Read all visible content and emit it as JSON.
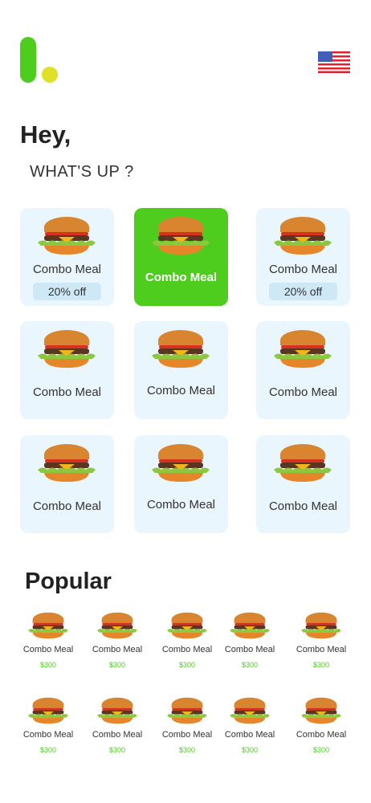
{
  "header": {
    "logo": "app-logo",
    "language": "en-US"
  },
  "greeting": {
    "title": "Hey,",
    "subtitle": "WHAT'S UP ?"
  },
  "categories": [
    {
      "name": "Combo Meal",
      "badge": "20% off",
      "selected": false
    },
    {
      "name": "Combo Meal",
      "selected": true
    },
    {
      "name": "Combo Meal",
      "badge": "20% off",
      "selected": false
    },
    {
      "name": "Combo Meal"
    },
    {
      "name": "Combo Meal"
    },
    {
      "name": "Combo Meal"
    },
    {
      "name": "Combo Meal"
    },
    {
      "name": "Combo Meal"
    },
    {
      "name": "Combo Meal"
    }
  ],
  "popular": {
    "title": "Popular",
    "items": [
      {
        "name": "Combo Meal",
        "price": "$300"
      },
      {
        "name": "Combo Meal",
        "price": "$300"
      },
      {
        "name": "Combo Meal",
        "price": "$300"
      },
      {
        "name": "Combo Meal",
        "price": "$300"
      },
      {
        "name": "Combo Meal",
        "price": "$300"
      },
      {
        "name": "Combo Meal",
        "price": "$300"
      },
      {
        "name": "Combo Meal",
        "price": "$300"
      },
      {
        "name": "Combo Meal",
        "price": "$300"
      },
      {
        "name": "Combo Meal",
        "price": "$300"
      },
      {
        "name": "Combo Meal",
        "price": "$300"
      }
    ]
  },
  "colors": {
    "accent": "#4fcd1f",
    "card": "#e9f6fd",
    "logo_dot": "#dfe02a"
  }
}
